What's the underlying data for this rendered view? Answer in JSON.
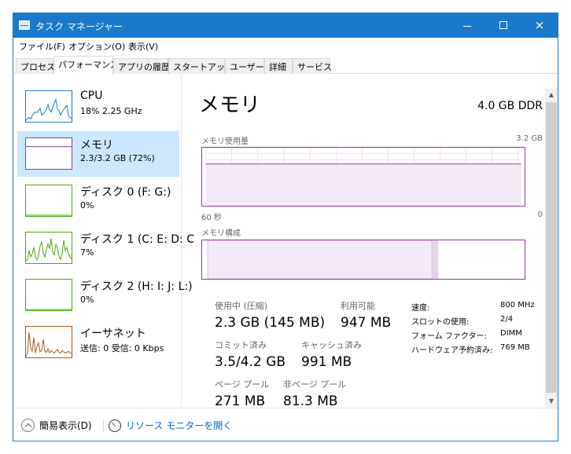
{
  "window": {
    "title": "タスク マネージャー"
  },
  "menu": [
    "ファイル(F)",
    "オプション(O)",
    "表示(V)"
  ],
  "tabs": [
    "プロセス",
    "パフォーマンス",
    "アプリの履歴",
    "スタートアップ",
    "ユーザー",
    "詳細",
    "サービス"
  ],
  "sidebar": {
    "items": [
      {
        "title": "CPU",
        "sub": "18%  2.25 GHz",
        "color": "#1979ca",
        "icon": "cpu-thumbnail-icon"
      },
      {
        "title": "メモリ",
        "sub": "2.3/3.2 GB (72%)",
        "color": "#8b3c9c",
        "icon": "memory-thumbnail-icon"
      },
      {
        "title": "ディスク 0 (F: G:)",
        "sub": "0%",
        "color": "#4da60c",
        "icon": "disk-thumbnail-icon"
      },
      {
        "title": "ディスク 1 (C: E: D: C",
        "sub": "7%",
        "color": "#4da60c",
        "icon": "disk-thumbnail-icon"
      },
      {
        "title": "ディスク 2 (H: I: J: L:)",
        "sub": "0%",
        "color": "#4da60c",
        "icon": "disk-thumbnail-icon"
      },
      {
        "title": "イーサネット",
        "sub": "送信: 0 受信: 0 Kbps",
        "color": "#a75b1d",
        "icon": "ethernet-thumbnail-icon"
      }
    ]
  },
  "main": {
    "title": "メモリ",
    "spec": "4.0 GB DDR",
    "usage_label": "メモリ使用量",
    "usage_max": "3.2 GB",
    "time_left": "60 秒",
    "time_right": "0",
    "composition_label": "メモリ構成",
    "stats": {
      "in_use_label": "使用中 (圧縮)",
      "in_use_value": "2.3 GB (145 MB)",
      "available_label": "利用可能",
      "available_value": "947 MB",
      "committed_label": "コミット済み",
      "committed_value": "3.5/4.2 GB",
      "cached_label": "キャッシュ済み",
      "cached_value": "991 MB",
      "paged_label": "ページ プール",
      "paged_value": "271 MB",
      "nonpaged_label": "非ページ プール",
      "nonpaged_value": "81.3 MB"
    },
    "right_stats": [
      {
        "label": "速度:",
        "value": "800 MHz"
      },
      {
        "label": "スロットの使用:",
        "value": "2/4"
      },
      {
        "label": "フォーム ファクター:",
        "value": "DIMM"
      },
      {
        "label": "ハードウェア予約済み:",
        "value": "769 MB"
      }
    ]
  },
  "footer": {
    "fewer_details": "簡易表示(D)",
    "resource_monitor": "リソース モニターを開く"
  },
  "memory_usage_fraction": 0.72,
  "composition": {
    "in_use_fraction": 0.72,
    "modified_fraction": 0.02
  },
  "chart_data": [
    {
      "type": "line",
      "name": "cpu",
      "values": [
        4,
        8,
        12,
        6,
        18,
        25,
        30,
        28,
        35,
        42,
        20,
        24,
        30,
        40,
        55,
        38,
        30,
        45,
        60,
        72,
        40,
        35,
        20,
        30,
        38,
        46,
        52,
        18,
        12,
        10
      ]
    },
    {
      "type": "line",
      "name": "memory",
      "values": [
        72,
        72,
        72,
        72,
        72,
        72,
        72,
        72,
        72,
        72,
        72,
        72,
        72,
        72,
        72,
        72,
        72,
        72,
        72,
        72,
        72,
        72,
        72,
        72,
        72,
        72,
        72,
        72,
        72,
        72
      ]
    },
    {
      "type": "line",
      "name": "disk0",
      "values": [
        0,
        0,
        0,
        0,
        0,
        0,
        0,
        0,
        0,
        0,
        0,
        0,
        0,
        0,
        0,
        0,
        0,
        0,
        0,
        0,
        0,
        0,
        0,
        0,
        0,
        0,
        0,
        0,
        0,
        0
      ]
    },
    {
      "type": "line",
      "name": "disk1",
      "values": [
        5,
        10,
        40,
        18,
        28,
        50,
        20,
        8,
        22,
        55,
        70,
        30,
        18,
        42,
        62,
        45,
        80,
        35,
        25,
        60,
        48,
        20,
        10,
        28,
        74,
        40,
        50,
        30,
        18,
        12
      ]
    },
    {
      "type": "line",
      "name": "disk2",
      "values": [
        0,
        0,
        0,
        0,
        0,
        0,
        0,
        0,
        0,
        0,
        0,
        0,
        0,
        0,
        0,
        0,
        0,
        0,
        0,
        0,
        0,
        0,
        0,
        0,
        0,
        0,
        0,
        0,
        0,
        0
      ]
    },
    {
      "type": "line",
      "name": "ethernet",
      "values": [
        0,
        12,
        82,
        30,
        18,
        64,
        12,
        34,
        46,
        16,
        22,
        58,
        18,
        14,
        26,
        12,
        20,
        16,
        12,
        18,
        24,
        14,
        12,
        20,
        16,
        12,
        14,
        18,
        12,
        10
      ]
    }
  ]
}
